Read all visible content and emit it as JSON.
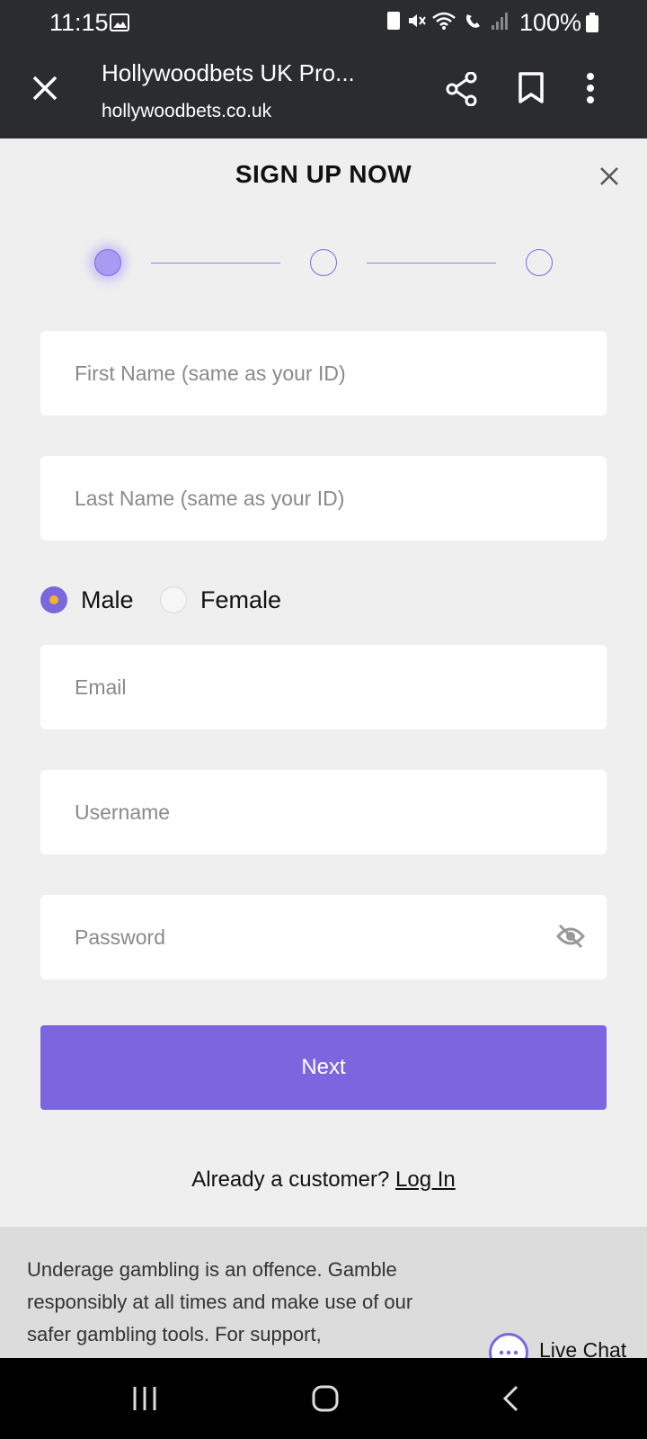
{
  "status_bar": {
    "time": "11:15",
    "battery": "100%"
  },
  "browser": {
    "title": "Hollywoodbets UK Pro...",
    "url": "hollywoodbets.co.uk"
  },
  "signup": {
    "title": "SIGN UP NOW",
    "fields": {
      "first_name_placeholder": "First Name (same as your ID)",
      "last_name_placeholder": "Last Name (same as your ID)",
      "email_placeholder": "Email",
      "username_placeholder": "Username",
      "password_placeholder": "Password"
    },
    "gender": {
      "options": [
        "Male",
        "Female"
      ],
      "selected": "Male"
    },
    "next_label": "Next",
    "customer_prompt": "Already a customer?",
    "login_label": "Log In",
    "steps": {
      "current": 1,
      "total": 3
    }
  },
  "footer": {
    "text": "Underage gambling is an offence. Gamble responsibly at all times and make use of our safer gambling tools. For support,",
    "live_chat_label": "Live Chat"
  },
  "colors": {
    "accent": "#7c66e0",
    "radio_dot": "#f2b233",
    "toolbar": "#2b2c30",
    "page_bg": "#efefef"
  }
}
